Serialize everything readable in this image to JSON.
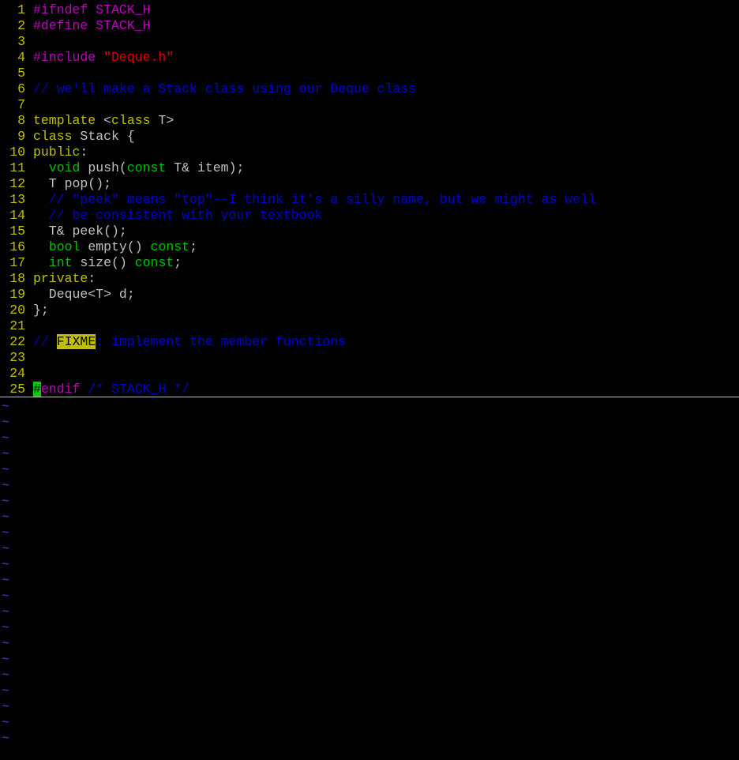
{
  "colors": {
    "line_number": "#c0c000",
    "preproc": "#c000c0",
    "string": "#e00000",
    "comment": "#0000d0",
    "type": "#00c000",
    "statement": "#c0c000",
    "normal": "#c0c0c0",
    "todo_bg": "#c0c000",
    "cursor_bg": "#00d000",
    "tilde": "#3a3aff"
  },
  "lines": [
    {
      "num": "1",
      "tokens": [
        {
          "t": "#ifndef STACK_H",
          "k": "preproc"
        }
      ]
    },
    {
      "num": "2",
      "tokens": [
        {
          "t": "#define STACK_H",
          "k": "preproc"
        }
      ]
    },
    {
      "num": "3",
      "tokens": []
    },
    {
      "num": "4",
      "tokens": [
        {
          "t": "#include ",
          "k": "preproc"
        },
        {
          "t": "\"Deque.h\"",
          "k": "string"
        }
      ]
    },
    {
      "num": "5",
      "tokens": []
    },
    {
      "num": "6",
      "tokens": [
        {
          "t": "// we'll make a Stack class using our Deque class",
          "k": "comment"
        }
      ]
    },
    {
      "num": "7",
      "tokens": []
    },
    {
      "num": "8",
      "tokens": [
        {
          "t": "template",
          "k": "statement"
        },
        {
          "t": " <",
          "k": "normal"
        },
        {
          "t": "class",
          "k": "statement"
        },
        {
          "t": " T>",
          "k": "normal"
        }
      ]
    },
    {
      "num": "9",
      "tokens": [
        {
          "t": "class",
          "k": "statement"
        },
        {
          "t": " Stack {",
          "k": "normal"
        }
      ]
    },
    {
      "num": "10",
      "tokens": [
        {
          "t": "public",
          "k": "statement"
        },
        {
          "t": ":",
          "k": "normal"
        }
      ]
    },
    {
      "num": "11",
      "tokens": [
        {
          "t": "  ",
          "k": "normal"
        },
        {
          "t": "void",
          "k": "type"
        },
        {
          "t": " push(",
          "k": "normal"
        },
        {
          "t": "const",
          "k": "type"
        },
        {
          "t": " T& item);",
          "k": "normal"
        }
      ]
    },
    {
      "num": "12",
      "tokens": [
        {
          "t": "  T pop();",
          "k": "normal"
        }
      ]
    },
    {
      "num": "13",
      "tokens": [
        {
          "t": "  // \"peek\" means \"top\"--I think it's a silly name, but we might as well",
          "k": "comment"
        }
      ]
    },
    {
      "num": "14",
      "tokens": [
        {
          "t": "  // be consistent with your textbook",
          "k": "comment"
        }
      ]
    },
    {
      "num": "15",
      "tokens": [
        {
          "t": "  T& peek();",
          "k": "normal"
        }
      ]
    },
    {
      "num": "16",
      "tokens": [
        {
          "t": "  ",
          "k": "normal"
        },
        {
          "t": "bool",
          "k": "type"
        },
        {
          "t": " empty() ",
          "k": "normal"
        },
        {
          "t": "const",
          "k": "type"
        },
        {
          "t": ";",
          "k": "normal"
        }
      ]
    },
    {
      "num": "17",
      "tokens": [
        {
          "t": "  ",
          "k": "normal"
        },
        {
          "t": "int",
          "k": "type"
        },
        {
          "t": " size() ",
          "k": "normal"
        },
        {
          "t": "const",
          "k": "type"
        },
        {
          "t": ";",
          "k": "normal"
        }
      ]
    },
    {
      "num": "18",
      "tokens": [
        {
          "t": "private",
          "k": "statement"
        },
        {
          "t": ":",
          "k": "normal"
        }
      ]
    },
    {
      "num": "19",
      "tokens": [
        {
          "t": "  Deque<T> d;",
          "k": "normal"
        }
      ]
    },
    {
      "num": "20",
      "tokens": [
        {
          "t": "};",
          "k": "normal"
        }
      ]
    },
    {
      "num": "21",
      "tokens": []
    },
    {
      "num": "22",
      "tokens": [
        {
          "t": "// ",
          "k": "comment"
        },
        {
          "t": "FIXME",
          "k": "todo"
        },
        {
          "t": ": implement the member functions",
          "k": "comment"
        }
      ]
    },
    {
      "num": "23",
      "tokens": []
    },
    {
      "num": "24",
      "tokens": []
    },
    {
      "num": "25",
      "cursorline": true,
      "tokens": [
        {
          "t": "#",
          "k": "cursor"
        },
        {
          "t": "endif",
          "k": "preproc"
        },
        {
          "t": " ",
          "k": "normal"
        },
        {
          "t": "/* STACK_H */",
          "k": "comment"
        }
      ]
    }
  ],
  "empty_line_marker": "~",
  "empty_line_count": 22
}
